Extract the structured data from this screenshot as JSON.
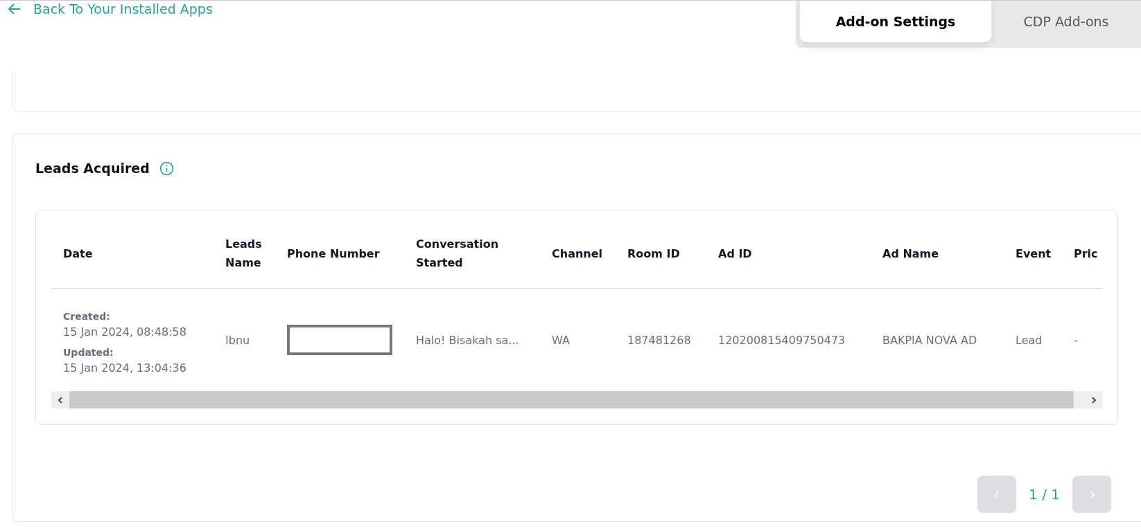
{
  "back_link": {
    "label": "Back To Your Installed Apps"
  },
  "tabs": [
    {
      "label": "Add-on Settings",
      "selected": true
    },
    {
      "label": "CDP Add-ons",
      "selected": false
    }
  ],
  "leads_card": {
    "title": "Leads Acquired",
    "table": {
      "columns": [
        "Date",
        "Leads Name",
        "Phone Number",
        "Conversation Started",
        "Channel",
        "Room ID",
        "Ad ID",
        "Ad Name",
        "Event",
        "Pric"
      ],
      "rows": [
        {
          "created_label": "Created:",
          "created": "15 Jan 2024, 08:48:58",
          "updated_label": "Updated:",
          "updated": "15 Jan 2024, 13:04:36",
          "leads_name": "Ibnu",
          "phone_redacted": true,
          "conversation": "Halo! Bisakah sa...",
          "channel": "WA",
          "room_id": "187481268",
          "ad_id": "120200815409750473",
          "ad_name": "BAKPIA NOVA AD",
          "event": "Lead",
          "price": "-"
        }
      ]
    },
    "pagination": {
      "prev_disabled": true,
      "page": "1 / 1",
      "next_disabled": true
    }
  }
}
